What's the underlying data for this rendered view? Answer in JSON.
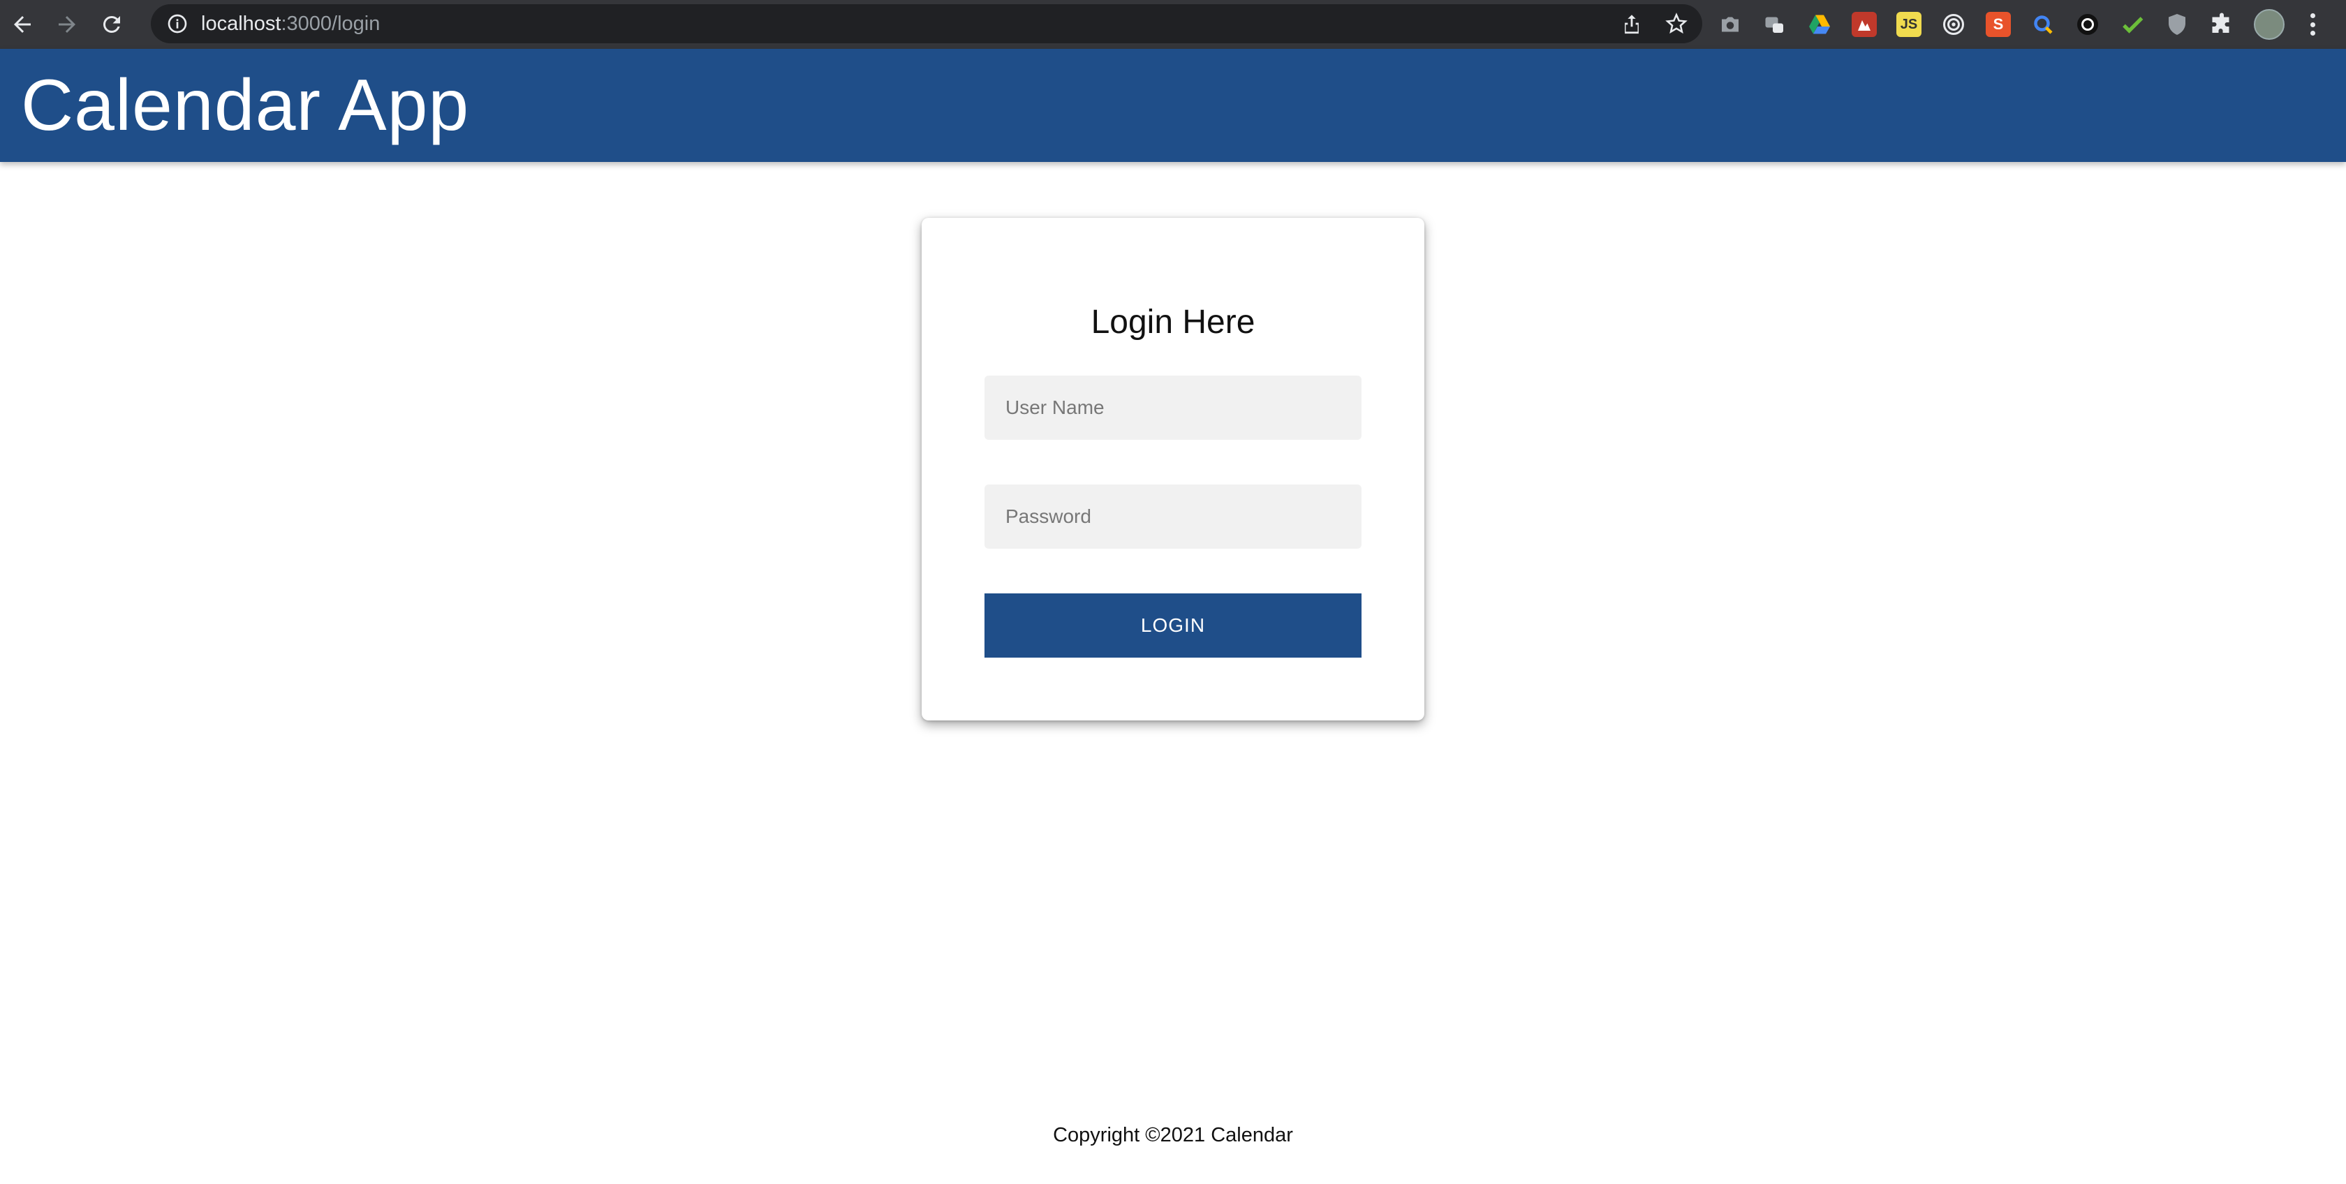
{
  "browser": {
    "url_host": "localhost",
    "url_path": ":3000/login",
    "extensions": [
      {
        "name": "camera-icon",
        "color": "#9aa0a6"
      },
      {
        "name": "tab-manager-icon",
        "color": "#9aa0a6"
      },
      {
        "name": "google-drive-icon",
        "color": "#1fa463"
      },
      {
        "name": "red-extension-icon",
        "color": "#d93025"
      },
      {
        "name": "js-icon",
        "color": "#f0db4f"
      },
      {
        "name": "target-icon",
        "color": "#e8eaed"
      },
      {
        "name": "s-extension-icon",
        "color": "#e8532b"
      },
      {
        "name": "search-extension-icon",
        "color": "#4285f4"
      },
      {
        "name": "circle-extension-icon",
        "color": "#111111"
      },
      {
        "name": "checkmark-icon",
        "color": "#6cbf3a"
      },
      {
        "name": "shield-icon",
        "color": "#9aa0a6"
      },
      {
        "name": "puzzle-icon",
        "color": "#e8eaed"
      }
    ]
  },
  "header": {
    "title": "Calendar App",
    "background": "#1f4e89"
  },
  "login": {
    "title": "Login Here",
    "username_placeholder": "User Name",
    "username_value": "",
    "password_placeholder": "Password",
    "password_value": "",
    "button_label": "LOGIN"
  },
  "footer": {
    "text": "Copyright ©2021 Calendar"
  }
}
